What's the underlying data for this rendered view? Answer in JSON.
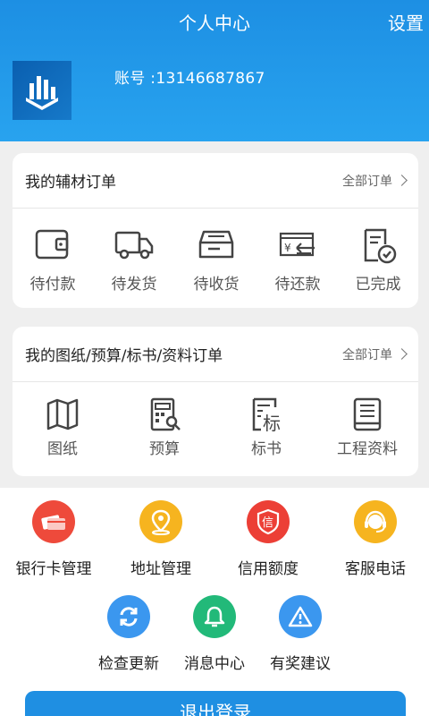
{
  "header": {
    "title": "个人中心",
    "settings": "设置",
    "account": "账号 :13146687867"
  },
  "card1": {
    "title": "我的辅材订单",
    "more": "全部订单",
    "items": [
      {
        "label": "待付款",
        "icon": "wallet-icon"
      },
      {
        "label": "待发货",
        "icon": "truck-icon"
      },
      {
        "label": "待收货",
        "icon": "inbox-icon"
      },
      {
        "label": "待还款",
        "icon": "repay-icon"
      },
      {
        "label": "已完成",
        "icon": "completed-doc-icon"
      }
    ]
  },
  "card2": {
    "title": "我的图纸/预算/标书/资料订单",
    "more": "全部订单",
    "items": [
      {
        "label": "图纸",
        "icon": "map-icon"
      },
      {
        "label": "预算",
        "icon": "calculator-icon"
      },
      {
        "label": "标书",
        "icon": "bid-doc-icon"
      },
      {
        "label": "工程资料",
        "icon": "book-icon"
      }
    ]
  },
  "services": [
    {
      "label": "银行卡管理",
      "icon": "bank-card-icon",
      "color": "#ee4a3b"
    },
    {
      "label": "地址管理",
      "icon": "location-icon",
      "color": "#f6b41f"
    },
    {
      "label": "信用额度",
      "icon": "credit-icon",
      "color": "#ec3f36"
    },
    {
      "label": "客服电话",
      "icon": "headset-icon",
      "color": "#f6b41f"
    },
    {
      "label": "检查更新",
      "icon": "refresh-icon",
      "color": "#3b97ef"
    },
    {
      "label": "消息中心",
      "icon": "bell-icon",
      "color": "#22b979"
    },
    {
      "label": "有奖建议",
      "icon": "warning-icon",
      "color": "#3b97ef"
    }
  ],
  "logout": "退出登录"
}
